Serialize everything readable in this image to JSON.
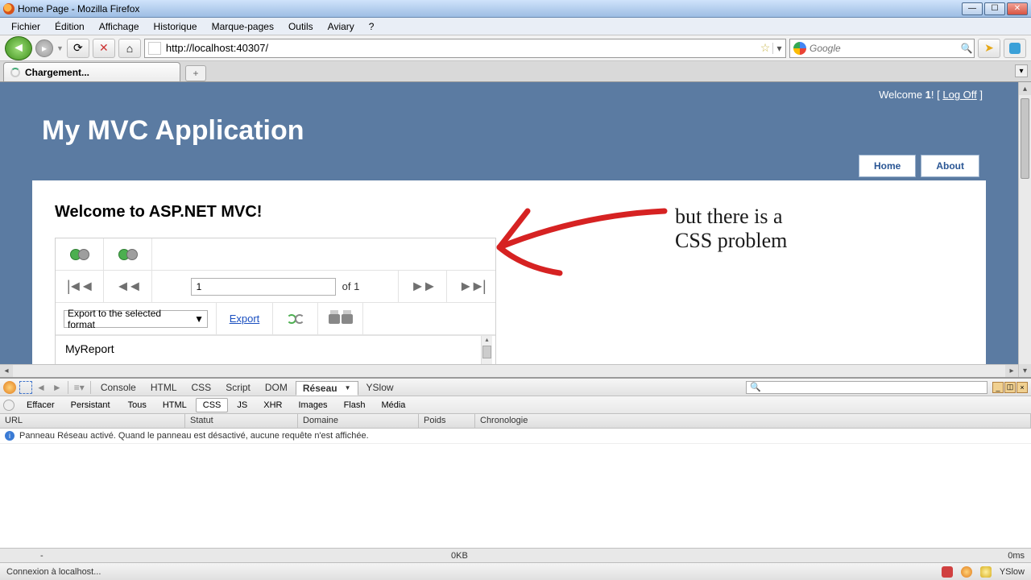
{
  "window": {
    "title": "Home Page - Mozilla Firefox"
  },
  "menu": {
    "file": "Fichier",
    "edit": "Édition",
    "view": "Affichage",
    "history": "Historique",
    "bookmarks": "Marque-pages",
    "tools": "Outils",
    "aviary": "Aviary",
    "help": "?"
  },
  "nav": {
    "url": "http://localhost:40307/",
    "search_placeholder": "Google"
  },
  "tab": {
    "label": "Chargement..."
  },
  "page": {
    "welcome_prefix": "Welcome ",
    "welcome_user": "1",
    "logoff": "Log Off",
    "app_title": "My MVC Application",
    "nav_home": "Home",
    "nav_about": "About",
    "heading": "Welcome to ASP.NET MVC!",
    "report": {
      "page_current": "1",
      "page_of": "of 1",
      "export_format": "Export to the selected format",
      "export_link": "Export",
      "report_name": "MyReport"
    }
  },
  "annotation": {
    "line1": "but there is a",
    "line2": "CSS problem"
  },
  "firebug": {
    "tabs": {
      "console": "Console",
      "html": "HTML",
      "css": "CSS",
      "script": "Script",
      "dom": "DOM",
      "net": "Réseau",
      "yslow": "YSlow"
    },
    "sub": {
      "clear": "Effacer",
      "persist": "Persistant",
      "all": "Tous",
      "html": "HTML",
      "css": "CSS",
      "js": "JS",
      "xhr": "XHR",
      "images": "Images",
      "flash": "Flash",
      "media": "Média"
    },
    "headers": {
      "url": "URL",
      "status": "Statut",
      "domain": "Domaine",
      "size": "Poids",
      "timeline": "Chronologie"
    },
    "message": "Panneau Réseau activé. Quand le panneau est désactivé, aucune requête n'est affichée.",
    "summary": {
      "requests": "-",
      "size": "0KB",
      "time": "0ms"
    }
  },
  "status": {
    "text": "Connexion à localhost...",
    "yslow": "YSlow"
  }
}
